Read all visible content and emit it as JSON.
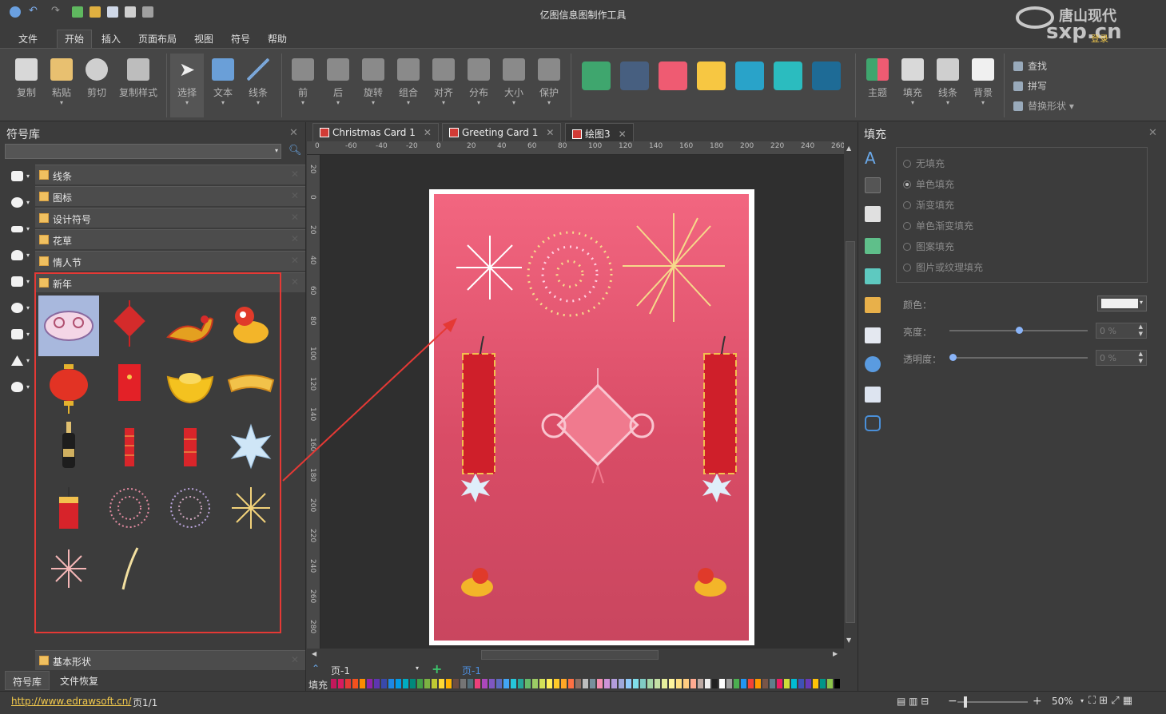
{
  "app": {
    "title": "亿图信息图制作工具",
    "logo_text": "唐山现代",
    "logo_sub": "sxp.cn",
    "login": "登录"
  },
  "menu": [
    "文件",
    "开始",
    "插入",
    "页面布局",
    "视图",
    "符号",
    "帮助"
  ],
  "ribbon": {
    "clipboard": [
      "复制",
      "粘贴",
      "剪切",
      "复制样式"
    ],
    "tools": [
      "选择",
      "文本",
      "线条"
    ],
    "arrange": [
      "前",
      "后",
      "旋转",
      "组合",
      "对齐",
      "分布",
      "大小",
      "保护"
    ],
    "swatches": [
      "#3fa66e",
      "#475f80",
      "#ef5b72",
      "#f7c742",
      "#29a3c9",
      "#2bbcbf",
      "#1e6b96"
    ],
    "style": [
      "主题",
      "填充",
      "线条",
      "背景"
    ],
    "edit": [
      "查找",
      "拼写",
      "替换形状"
    ]
  },
  "library": {
    "title": "符号库",
    "categories": [
      "线条",
      "图标",
      "设计符号",
      "花草",
      "情人节",
      "新年"
    ],
    "basic": "基本形状",
    "tabs": [
      "符号库",
      "文件恢复"
    ]
  },
  "doc_tabs": [
    "Christmas Card 1",
    "Greeting Card 1",
    "绘图3"
  ],
  "ruler_h": [
    "0",
    "-60",
    "-40",
    "-20",
    "0",
    "20",
    "40",
    "60",
    "80",
    "100",
    "120",
    "140",
    "160",
    "180",
    "200",
    "220",
    "240",
    "260"
  ],
  "ruler_v": [
    "20",
    "0",
    "20",
    "40",
    "60",
    "80",
    "100",
    "120",
    "140",
    "160",
    "180",
    "200",
    "220",
    "240",
    "260",
    "280"
  ],
  "page_nav": {
    "current": "页-1",
    "tab": "页-1"
  },
  "fill_label": "填充",
  "fill_panel": {
    "title": "填充",
    "options": [
      "无填充",
      "单色填充",
      "渐变填充",
      "单色渐变填充",
      "图案填充",
      "图片或纹理填充"
    ],
    "selected": 1,
    "color_label": "颜色：",
    "brightness_label": "亮度：",
    "transparency_label": "透明度：",
    "brightness_value": "0 %",
    "transparency_value": "0 %",
    "brightness_level": 0.5,
    "transparency_level": 0.0
  },
  "status": {
    "url": "http://www.edrawsoft.cn/",
    "page": "页1/1",
    "zoom": "50%"
  }
}
